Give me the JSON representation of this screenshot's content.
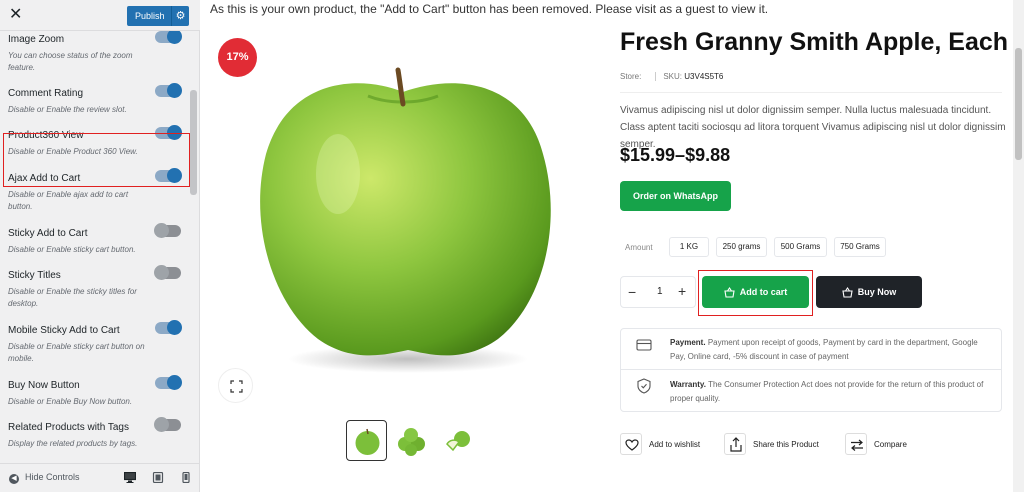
{
  "customizer": {
    "close_glyph": "✕",
    "publish_label": "Publish",
    "gear_glyph": "⚙",
    "options": [
      {
        "title": "Image Zoom",
        "desc": "You can choose status of the zoom feature.",
        "enabled": true
      },
      {
        "title": "Comment Rating",
        "desc": "Disable or Enable the review slot.",
        "enabled": true
      },
      {
        "title": "Product360 View",
        "desc": "Disable or Enable Product 360 View.",
        "enabled": true
      },
      {
        "title": "Ajax Add to Cart",
        "desc": "Disable or Enable ajax add to cart button.",
        "enabled": true
      },
      {
        "title": "Sticky Add to Cart",
        "desc": "Disable or Enable sticky cart button.",
        "enabled": false
      },
      {
        "title": "Sticky Titles",
        "desc": "Disable or Enable the sticky titles for desktop.",
        "enabled": false
      },
      {
        "title": "Mobile Sticky Add to Cart",
        "desc": "Disable or Enable sticky cart button on mobile.",
        "enabled": true
      },
      {
        "title": "Buy Now Button",
        "desc": "Disable or Enable Buy Now button.",
        "enabled": true
      },
      {
        "title": "Related Products with Tags",
        "desc": "Display the related products by tags.",
        "enabled": false
      }
    ],
    "hide_controls": "Hide Controls"
  },
  "notice": "As this is your own product, the \"Add to Cart\" button has been removed. Please visit as a guest to view it.",
  "product": {
    "discount_badge": "17%",
    "title": "Fresh Granny Smith Apple, Each",
    "store_label": "Store:",
    "sku_label": "SKU:",
    "sku": "U3V4S5T6",
    "description": "Vivamus adipiscing nisl ut dolor dignissim semper. Nulla luctus malesuada tincidunt. Class aptent taciti sociosqu ad litora torquent Vivamus adipiscing nisl ut dolor dignissim semper.",
    "price": "$15.99–$9.88",
    "whatsapp_label": "Order on WhatsApp",
    "amount_label": "Amount",
    "amount_options": [
      "1 KG",
      "250 grams",
      "500 Grams",
      "750 Grams"
    ],
    "quantity": "1",
    "minus": "−",
    "plus": "+",
    "add_to_cart": "Add to cart",
    "buy_now": "Buy Now",
    "payment_title": "Payment.",
    "payment_text": "Payment upon receipt of goods, Payment by card in the department, Google Pay, Online card, -5% discount in case of payment",
    "warranty_title": "Warranty.",
    "warranty_text": "The Consumer Protection Act does not provide for the return of this product of proper quality.",
    "actions": [
      "Add to wishlist",
      "Share this Product",
      "Compare"
    ]
  },
  "colors": {
    "accent": "#16a34a",
    "badge": "#e12c35",
    "publish": "#2271b1",
    "highlight": "#e02020",
    "dark_button": "#1f2328"
  }
}
